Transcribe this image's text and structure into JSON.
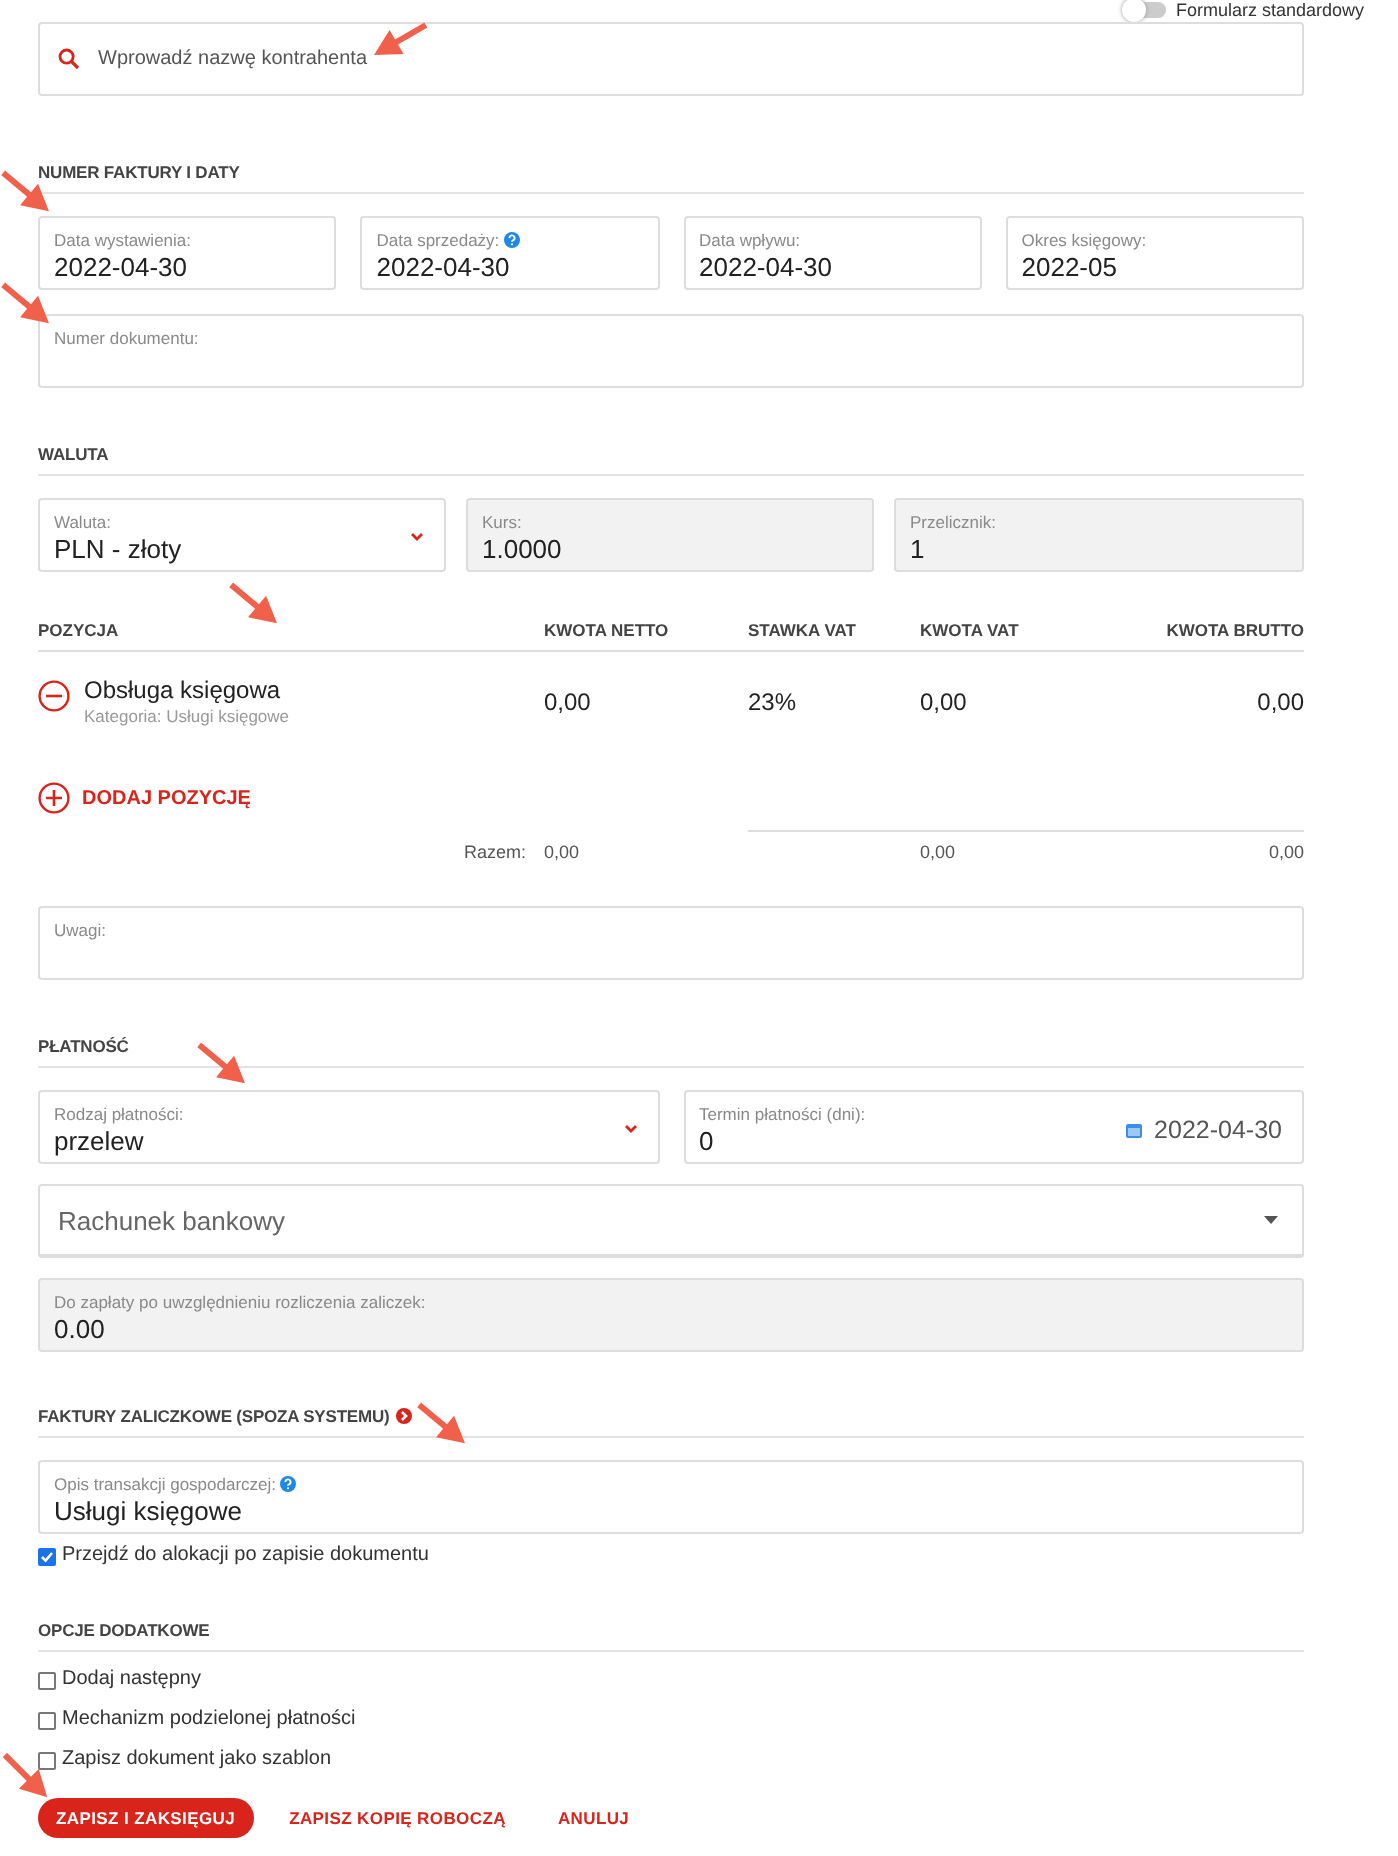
{
  "form_toggle": {
    "label": "Formularz standardowy",
    "on": false
  },
  "contractor_search": {
    "placeholder": "Wprowadź nazwę kontrahenta"
  },
  "invoice_section": {
    "title": "NUMER FAKTURY I DATY",
    "date_fields": [
      {
        "label": "Data wystawienia:",
        "value": "2022-04-30",
        "kind": "text",
        "help": false
      },
      {
        "label": "Data sprzedaży:",
        "value": "2022-04-30",
        "kind": "text",
        "help": true
      },
      {
        "label": "Data wpływu:",
        "value": "2022-04-30",
        "kind": "text",
        "help": false
      },
      {
        "label": "Okres księgowy:",
        "value": "2022-05",
        "kind": "text",
        "help": false
      }
    ],
    "document_number": {
      "label": "Numer dokumentu:",
      "kind": "text",
      "help": false
    }
  },
  "currency_section": {
    "title": "WALUTA",
    "fields": [
      {
        "label": "Waluta:",
        "value": "PLN - złoty",
        "kind": "select",
        "help": false
      },
      {
        "label": "Kurs:",
        "value": "1.0000",
        "kind": "readonly",
        "help": false
      },
      {
        "label": "Przelicznik:",
        "value": "1",
        "kind": "readonly",
        "help": false
      }
    ]
  },
  "positions_table": {
    "columns": [
      "POZYCJA",
      "KWOTA NETTO",
      "STAWKA VAT",
      "KWOTA VAT",
      "KWOTA BRUTTO"
    ],
    "rows": [
      {
        "name": "Obsługa księgowa",
        "category": "Kategoria: Usługi księgowe",
        "net": "0,00",
        "vat_rate": "23%",
        "vat": "0,00",
        "gross": "0,00"
      }
    ],
    "add_label": "DODAJ POZYCJĘ",
    "totals": {
      "label": "Razem:",
      "net": "0,00",
      "vat": "0,00",
      "gross": "0,00"
    }
  },
  "notes": {
    "label": "Uwagi:",
    "kind": "text",
    "help": false
  },
  "payment_section": {
    "title": "PŁATNOŚĆ",
    "fields": [
      {
        "label": "Rodzaj płatności:",
        "value": "przelew",
        "kind": "select",
        "help": false
      },
      {
        "label": "Termin płatności (dni):",
        "value": "0",
        "kind": "date",
        "due_date": "2022-04-30",
        "help": false
      }
    ],
    "bank_account": {
      "placeholder": "Rachunek bankowy"
    },
    "to_pay": {
      "label": "Do zapłaty po uwzględnieniu rozliczenia zaliczek:",
      "value": "0.00",
      "kind": "readonly",
      "help": false
    }
  },
  "advance_section": {
    "title": "FAKTURY ZALICZKOWE (SPOZA SYSTEMU)",
    "link_icon": true,
    "description": {
      "label": "Opis transakcji gospodarczej:",
      "value": "Usługi księgowe",
      "kind": "text",
      "help": true
    },
    "allocation_checkbox": {
      "label": "Przejdź do alokacji po zapisie dokumentu",
      "checked": true
    }
  },
  "options_section": {
    "title": "OPCJE DODATKOWE",
    "options": [
      {
        "label": "Dodaj następny",
        "checked": false
      },
      {
        "label": "Mechanizm podzielonej płatności",
        "checked": false
      },
      {
        "label": "Zapisz dokument jako szablon",
        "checked": false
      }
    ]
  },
  "actions": [
    {
      "label": "ZAPISZ I ZAKSIĘGUJ",
      "kind": "primary"
    },
    {
      "label": "ZAPISZ KOPIĘ ROBOCZĄ",
      "kind": "link"
    },
    {
      "label": "ANULUJ",
      "kind": "link"
    }
  ]
}
